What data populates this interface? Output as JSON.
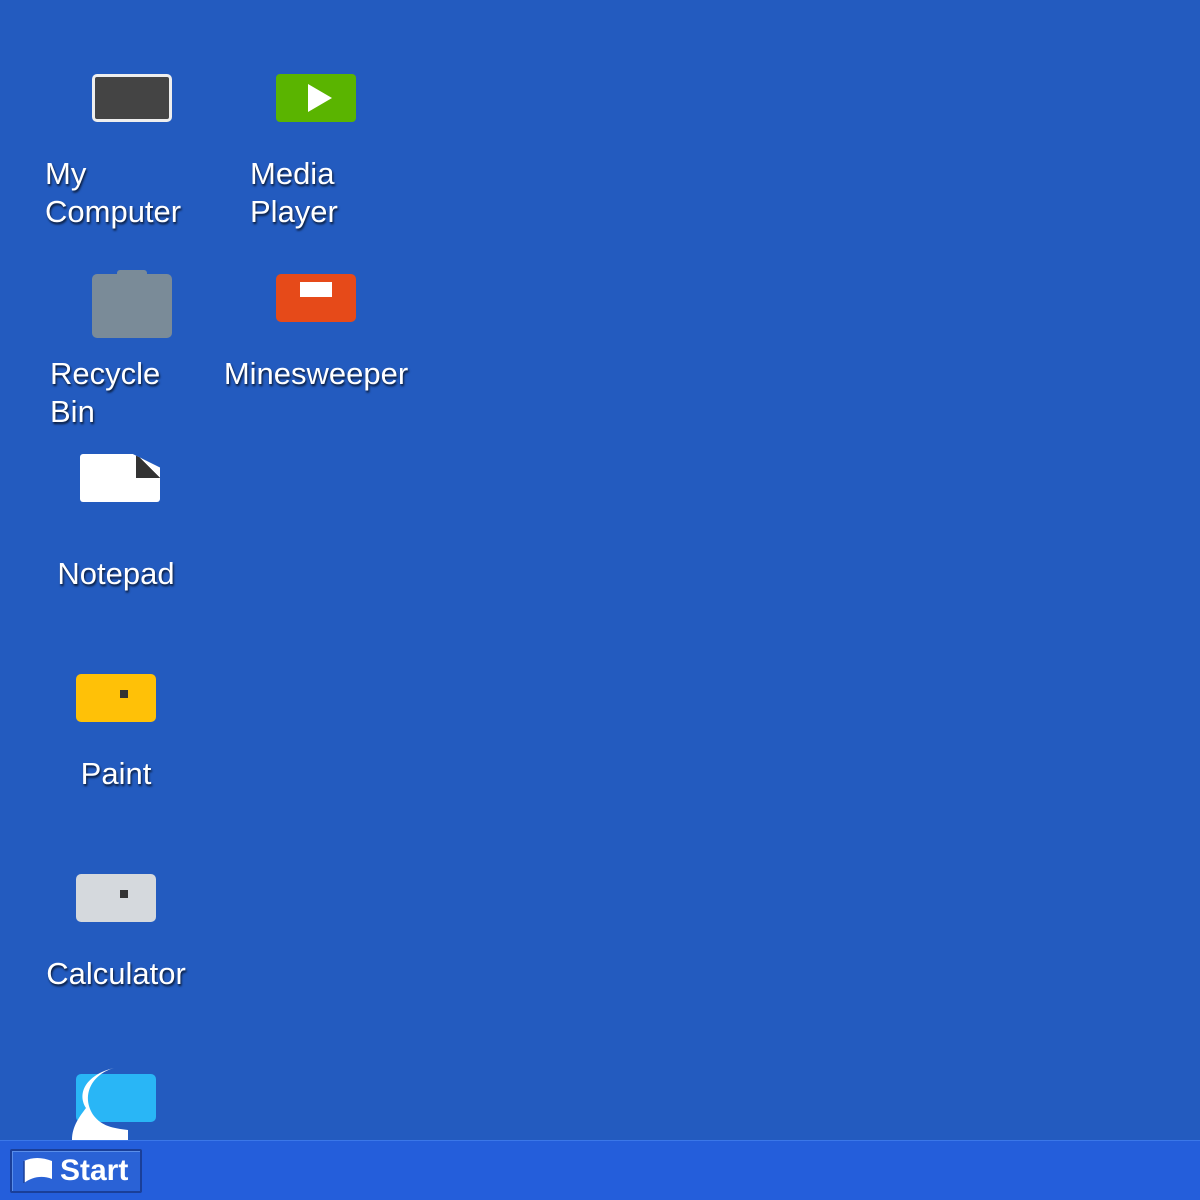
{
  "colors": {
    "desktop_background": "#235bbf",
    "taskbar": "#245edb"
  },
  "desktop": {
    "icons": [
      {
        "id": "my-computer",
        "label_lines": [
          "My",
          "Computer"
        ],
        "icon": "computer-icon"
      },
      {
        "id": "media-player",
        "label_lines": [
          "Media",
          "Player"
        ],
        "icon": "media-player-icon"
      },
      {
        "id": "recycle-bin",
        "label_lines": [
          "Recycle",
          "Bin"
        ],
        "icon": "recycle-bin-icon"
      },
      {
        "id": "minesweeper",
        "label_lines": [
          "Minesweeper"
        ],
        "icon": "minesweeper-icon"
      },
      {
        "id": "notepad",
        "label_lines": [
          "Notepad"
        ],
        "icon": "notepad-icon"
      },
      {
        "id": "paint",
        "label_lines": [
          "Paint"
        ],
        "icon": "paint-icon"
      },
      {
        "id": "calculator",
        "label_lines": [
          "Calculator"
        ],
        "icon": "calculator-icon"
      },
      {
        "id": "unlabeled-app",
        "label_lines": [],
        "icon": "chat-app-icon"
      }
    ]
  },
  "taskbar": {
    "start_label": "Start",
    "start_icon": "start-flag-icon"
  }
}
